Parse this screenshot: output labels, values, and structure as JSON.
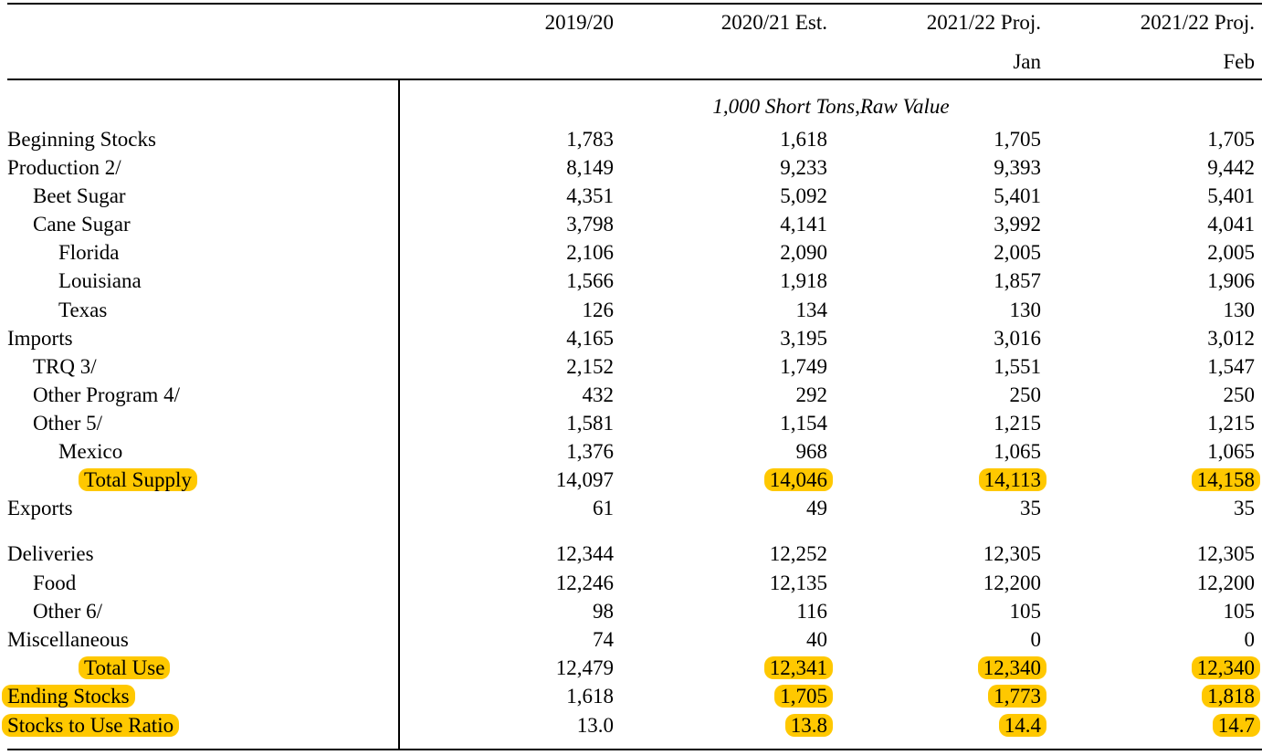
{
  "table": {
    "headers": [
      {
        "line1": "2019/20",
        "line2": ""
      },
      {
        "line1": "2020/21 Est.",
        "line2": ""
      },
      {
        "line1": "2021/22 Proj.",
        "line2": "Jan"
      },
      {
        "line1": "2021/22 Proj.",
        "line2": "Feb"
      }
    ],
    "units": "1,000 Short Tons,Raw Value",
    "rows": [
      {
        "label": "Beginning Stocks",
        "indent": 0,
        "values": [
          "1,783",
          "1,618",
          "1,705",
          "1,705"
        ],
        "label_hl": false,
        "hl": [
          false,
          false,
          false,
          false
        ]
      },
      {
        "label": "Production 2/",
        "indent": 0,
        "values": [
          "8,149",
          "9,233",
          "9,393",
          "9,442"
        ],
        "label_hl": false,
        "hl": [
          false,
          false,
          false,
          false
        ]
      },
      {
        "label": "Beet Sugar",
        "indent": 1,
        "values": [
          "4,351",
          "5,092",
          "5,401",
          "5,401"
        ],
        "label_hl": false,
        "hl": [
          false,
          false,
          false,
          false
        ]
      },
      {
        "label": "Cane Sugar",
        "indent": 1,
        "values": [
          "3,798",
          "4,141",
          "3,992",
          "4,041"
        ],
        "label_hl": false,
        "hl": [
          false,
          false,
          false,
          false
        ]
      },
      {
        "label": "Florida",
        "indent": 2,
        "values": [
          "2,106",
          "2,090",
          "2,005",
          "2,005"
        ],
        "label_hl": false,
        "hl": [
          false,
          false,
          false,
          false
        ]
      },
      {
        "label": "Louisiana",
        "indent": 2,
        "values": [
          "1,566",
          "1,918",
          "1,857",
          "1,906"
        ],
        "label_hl": false,
        "hl": [
          false,
          false,
          false,
          false
        ]
      },
      {
        "label": "Texas",
        "indent": 2,
        "values": [
          "126",
          "134",
          "130",
          "130"
        ],
        "label_hl": false,
        "hl": [
          false,
          false,
          false,
          false
        ]
      },
      {
        "label": "Imports",
        "indent": 0,
        "values": [
          "4,165",
          "3,195",
          "3,016",
          "3,012"
        ],
        "label_hl": false,
        "hl": [
          false,
          false,
          false,
          false
        ]
      },
      {
        "label": "TRQ 3/",
        "indent": 1,
        "values": [
          "2,152",
          "1,749",
          "1,551",
          "1,547"
        ],
        "label_hl": false,
        "hl": [
          false,
          false,
          false,
          false
        ]
      },
      {
        "label": "Other Program 4/",
        "indent": 1,
        "values": [
          "432",
          "292",
          "250",
          "250"
        ],
        "label_hl": false,
        "hl": [
          false,
          false,
          false,
          false
        ]
      },
      {
        "label": "Other 5/",
        "indent": 1,
        "values": [
          "1,581",
          "1,154",
          "1,215",
          "1,215"
        ],
        "label_hl": false,
        "hl": [
          false,
          false,
          false,
          false
        ]
      },
      {
        "label": "Mexico",
        "indent": 2,
        "values": [
          "1,376",
          "968",
          "1,065",
          "1,065"
        ],
        "label_hl": false,
        "hl": [
          false,
          false,
          false,
          false
        ]
      },
      {
        "label": "Total Supply",
        "indent": 3,
        "values": [
          "14,097",
          "14,046",
          "14,113",
          "14,158"
        ],
        "label_hl": true,
        "hl": [
          false,
          true,
          true,
          true
        ]
      },
      {
        "label": "Exports",
        "indent": 0,
        "values": [
          "61",
          "49",
          "35",
          "35"
        ],
        "label_hl": false,
        "hl": [
          false,
          false,
          false,
          false
        ]
      },
      {
        "label": "Deliveries",
        "indent": 0,
        "values": [
          "12,344",
          "12,252",
          "12,305",
          "12,305"
        ],
        "label_hl": false,
        "hl": [
          false,
          false,
          false,
          false
        ]
      },
      {
        "label": "Food",
        "indent": 1,
        "values": [
          "12,246",
          "12,135",
          "12,200",
          "12,200"
        ],
        "label_hl": false,
        "hl": [
          false,
          false,
          false,
          false
        ]
      },
      {
        "label": "Other 6/",
        "indent": 1,
        "values": [
          "98",
          "116",
          "105",
          "105"
        ],
        "label_hl": false,
        "hl": [
          false,
          false,
          false,
          false
        ]
      },
      {
        "label": "Miscellaneous",
        "indent": 0,
        "values": [
          "74",
          "40",
          "0",
          "0"
        ],
        "label_hl": false,
        "hl": [
          false,
          false,
          false,
          false
        ]
      },
      {
        "label": "Total Use",
        "indent": 3,
        "values": [
          "12,479",
          "12,341",
          "12,340",
          "12,340"
        ],
        "label_hl": true,
        "hl": [
          false,
          true,
          true,
          true
        ]
      },
      {
        "label": "Ending Stocks",
        "indent": 0,
        "values": [
          "1,618",
          "1,705",
          "1,773",
          "1,818"
        ],
        "label_hl": true,
        "hl": [
          false,
          true,
          true,
          true
        ]
      },
      {
        "label": "Stocks to Use Ratio",
        "indent": 0,
        "values": [
          "13.0",
          "13.8",
          "14.4",
          "14.7"
        ],
        "label_hl": true,
        "hl": [
          false,
          true,
          true,
          true
        ]
      }
    ]
  },
  "colors": {
    "highlight": "#ffc800",
    "text": "#000000",
    "rules": "#000000"
  }
}
